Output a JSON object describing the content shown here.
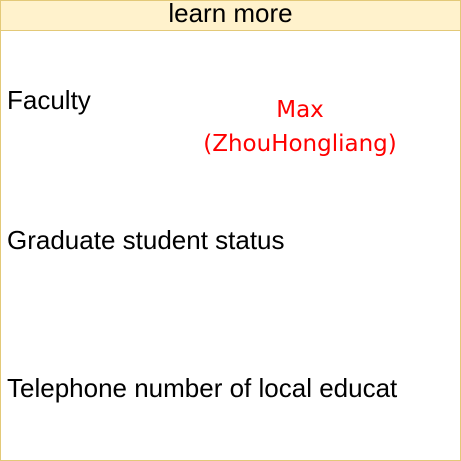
{
  "header": {
    "title": "learn more"
  },
  "rows": {
    "faculty": {
      "label": "Faculty",
      "value_line1": "Max",
      "value_line2": "(ZhouHongliang)"
    },
    "graduate_status": {
      "label": "Graduate student status"
    },
    "telephone": {
      "label": "Telephone number of local educat"
    }
  },
  "colors": {
    "header_background": "#fff2cc",
    "border": "#e3c978",
    "value_text": "#ff0000",
    "label_text": "#000000"
  }
}
